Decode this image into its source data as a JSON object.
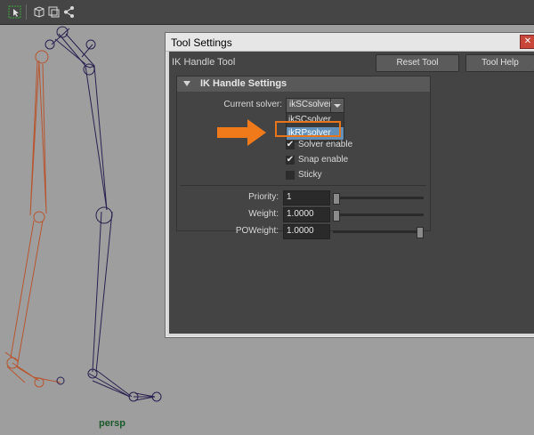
{
  "dialog": {
    "title": "Tool Settings",
    "close_glyph": "✕",
    "tool_name": "IK Handle Tool",
    "reset_button": "Reset Tool",
    "help_button": "Tool Help"
  },
  "section": {
    "title": "IK Handle Settings",
    "current_solver_label": "Current solver:",
    "current_solver_value": "ikSCsolver",
    "options": [
      "ikSCsolver",
      "ikRPsolver"
    ],
    "highlighted_option": "ikRPsolver"
  },
  "checkboxes": [
    {
      "label": "Solver enable",
      "checked": true
    },
    {
      "label": "Snap enable",
      "checked": true
    },
    {
      "label": "Sticky",
      "checked": false
    }
  ],
  "check_glyph": "✔",
  "fields": [
    {
      "label": "Priority:",
      "value": "1",
      "slider_fraction": 0.0
    },
    {
      "label": "Weight:",
      "value": "1.0000",
      "slider_fraction": 0.0
    },
    {
      "label": "POWeight:",
      "value": "1.0000",
      "slider_fraction": 1.0
    }
  ],
  "viewport": {
    "camera_label": "persp"
  },
  "colors": {
    "annotation_arrow": "#f07a1a",
    "highlight_border": "#e8751a",
    "left_leg_joints": "#b8552e",
    "right_leg_joints": "#2a2050",
    "selected_option": "#6290b8"
  },
  "icons": [
    "select-icon",
    "cube-icon",
    "frame-icon",
    "share-icon"
  ]
}
